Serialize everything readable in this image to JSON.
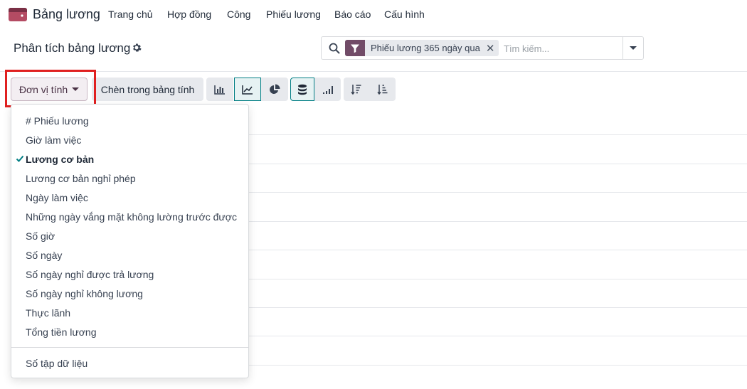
{
  "navbar": {
    "app_name": "Bảng lương",
    "items": [
      "Trang chủ",
      "Hợp đồng",
      "Công",
      "Phiếu lương",
      "Báo cáo",
      "Cấu hình"
    ]
  },
  "control_panel": {
    "title": "Phân tích bảng lương"
  },
  "search": {
    "facet_label": "Phiếu lương 365 ngày qua",
    "placeholder": "Tìm kiếm..."
  },
  "toolbar": {
    "measures_label": "Đơn vị tính",
    "insert_label": "Chèn trong bảng tính",
    "view_icons": [
      "bar-chart-icon",
      "line-chart-icon",
      "pie-chart-icon",
      "stacked-icon",
      "cumulative-icon",
      "sort-descending-icon",
      "sort-ascending-icon"
    ]
  },
  "measures_dropdown": {
    "items": [
      {
        "label": "# Phiếu lương",
        "selected": false
      },
      {
        "label": "Giờ làm việc",
        "selected": false
      },
      {
        "label": "Lương cơ bản",
        "selected": true
      },
      {
        "label": "Lương cơ bản nghỉ phép",
        "selected": false
      },
      {
        "label": "Ngày làm việc",
        "selected": false
      },
      {
        "label": "Những ngày vắng mặt không lường trước được",
        "selected": false
      },
      {
        "label": "Số giờ",
        "selected": false
      },
      {
        "label": "Số ngày",
        "selected": false
      },
      {
        "label": "Số ngày nghỉ được trả lương",
        "selected": false
      },
      {
        "label": "Số ngày nghỉ không lương",
        "selected": false
      },
      {
        "label": "Thực lãnh",
        "selected": false
      },
      {
        "label": "Tổng tiền lương",
        "selected": false
      }
    ],
    "footer_item": "Số tập dữ liệu"
  },
  "colors": {
    "brand": "#714b67",
    "active": "#017e84",
    "highlight": "#e02020"
  }
}
